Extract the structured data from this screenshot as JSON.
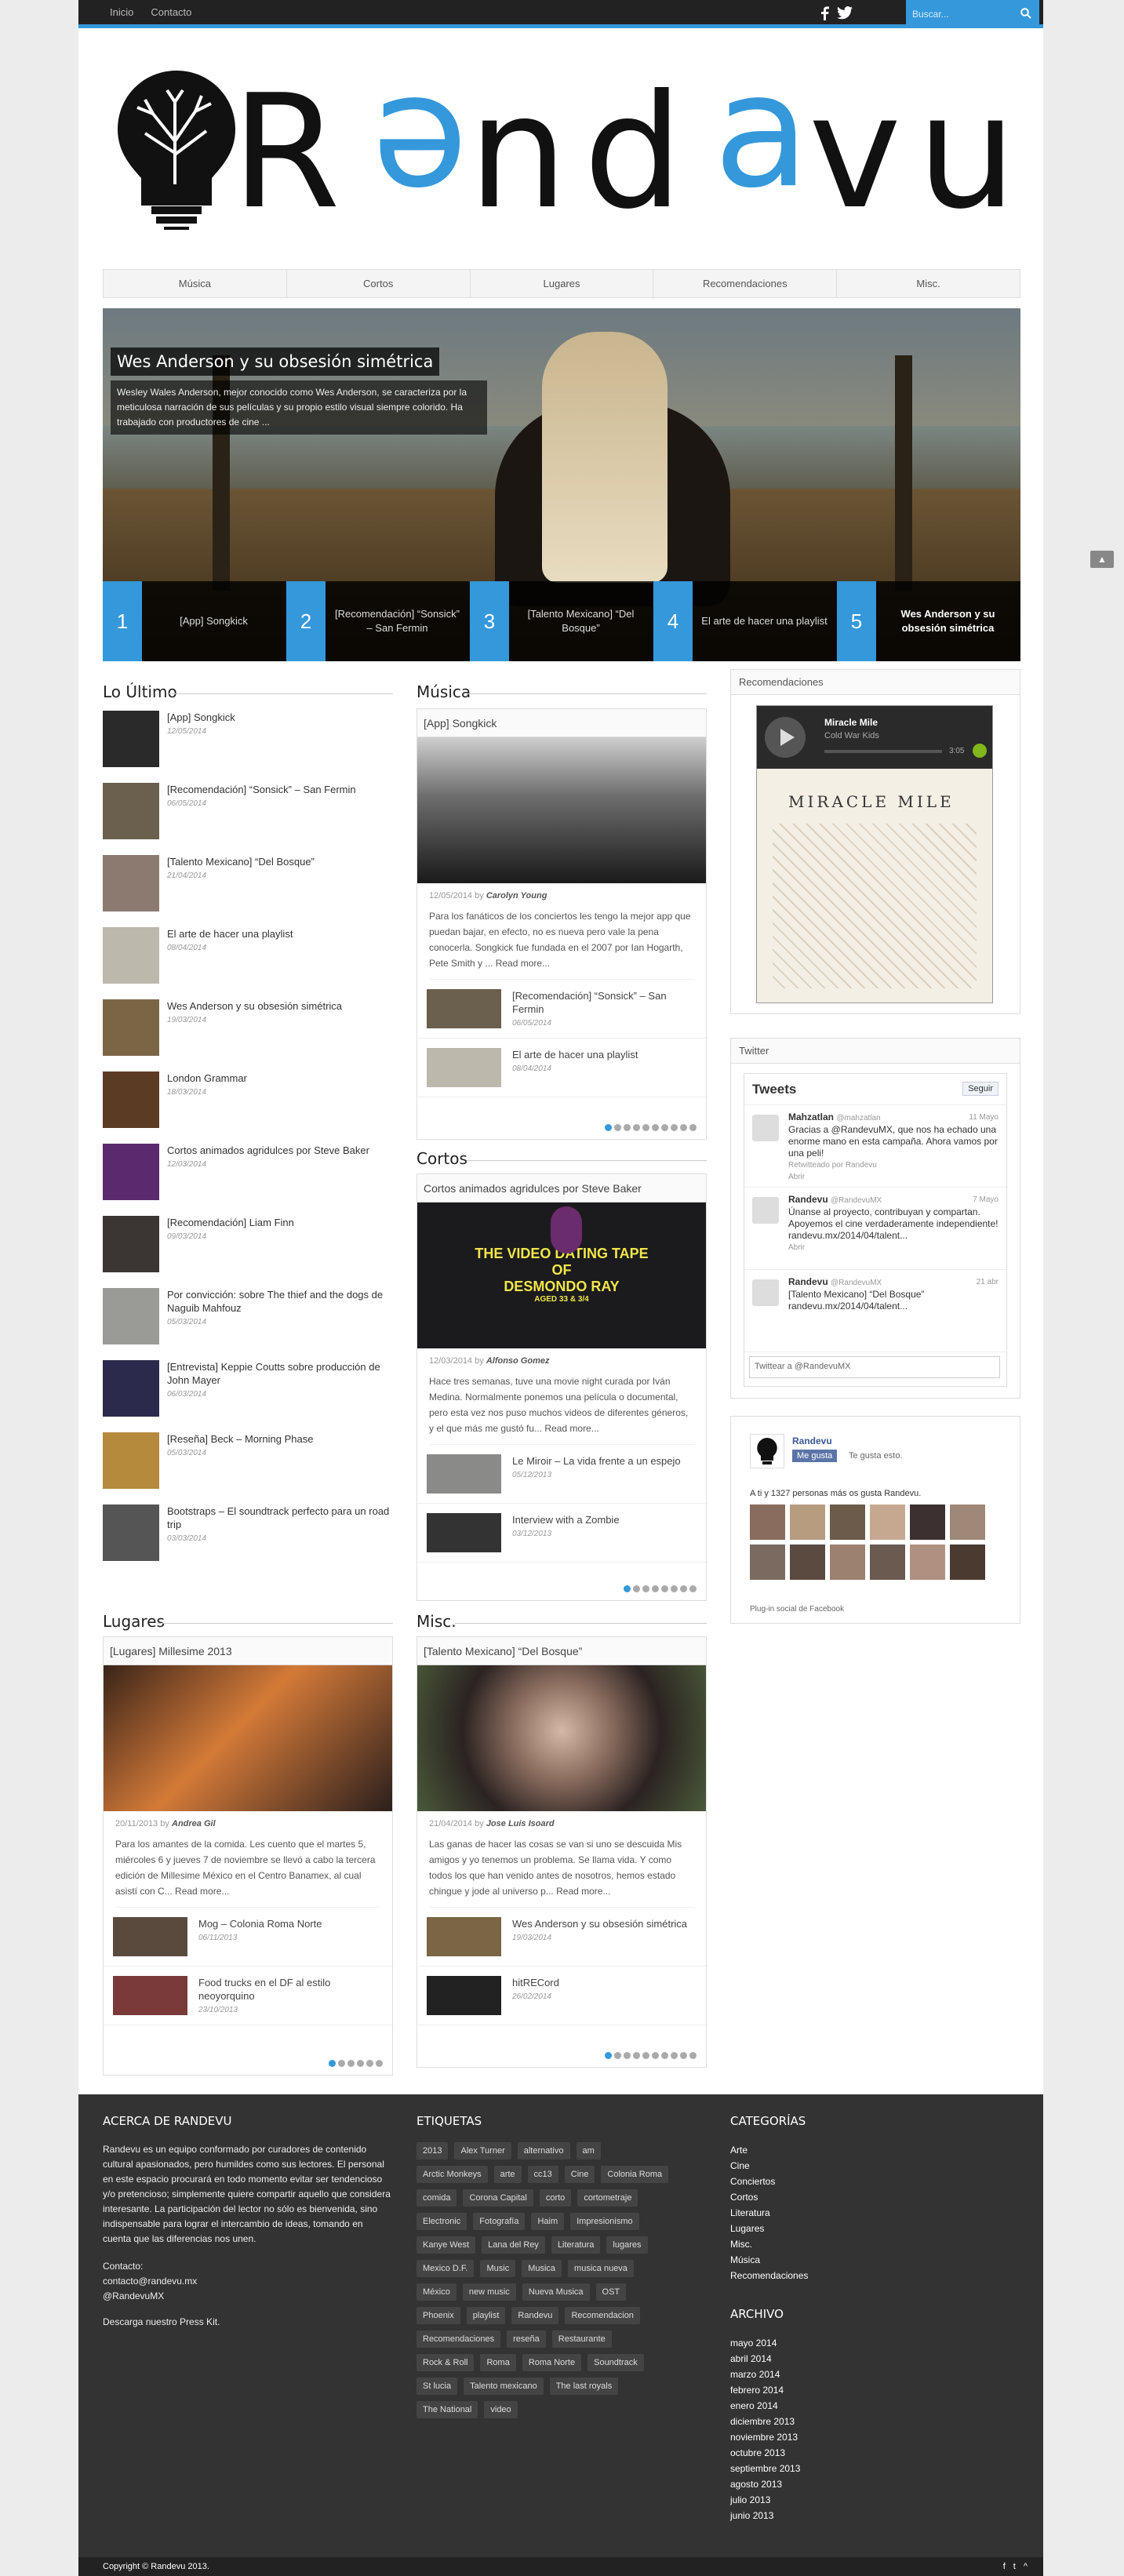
{
  "topnav": {
    "items": [
      "Inicio",
      "Contacto"
    ]
  },
  "search": {
    "placeholder": "Buscar..."
  },
  "logo": {
    "alt": "Randevu"
  },
  "mainnav": {
    "items": [
      "Música",
      "Cortos",
      "Lugares",
      "Recomendaciones",
      "Misc."
    ]
  },
  "slider": {
    "title": "Wes Anderson y su obsesión simétrica",
    "text": "Wesley Wales Anderson, mejor conocido como Wes Anderson, se caracteriza por la meticulosa narración de sus películas y su propio estilo visual siempre colorido. Ha trabajado con productores de cine ...",
    "tabs": [
      {
        "num": "1",
        "label": "[App] Songkick"
      },
      {
        "num": "2",
        "label": "[Recomendación] “Sonsick” – San Fermin"
      },
      {
        "num": "3",
        "label": "[Talento Mexicano] “Del Bosque”"
      },
      {
        "num": "4",
        "label": "El arte de hacer una playlist"
      },
      {
        "num": "5",
        "label": "Wes Anderson y su obsesión simétrica"
      }
    ]
  },
  "latest": {
    "heading": "Lo Último",
    "items": [
      {
        "title": "[App] Songkick",
        "date": "12/05/2014",
        "color": "#2a2a2a"
      },
      {
        "title": "[Recomendación] “Sonsick” – San Fermin",
        "date": "06/05/2014",
        "color": "#6b5f4d"
      },
      {
        "title": "[Talento Mexicano] “Del Bosque”",
        "date": "21/04/2014",
        "color": "#8c7a70"
      },
      {
        "title": "El arte de hacer una playlist",
        "date": "08/04/2014",
        "color": "#bcb8ac"
      },
      {
        "title": "Wes Anderson y su obsesión simétrica",
        "date": "19/03/2014",
        "color": "#7a6645"
      },
      {
        "title": "London Grammar",
        "date": "18/03/2014",
        "color": "#5c3b24"
      },
      {
        "title": "Cortos animados agridulces por Steve Baker",
        "date": "12/03/2014",
        "color": "#5b2a6e"
      },
      {
        "title": "[Recomendación] Liam Finn",
        "date": "09/03/2014",
        "color": "#3b3533"
      },
      {
        "title": "Por convicción: sobre The thief and the dogs de Naguib Mahfouz",
        "date": "05/03/2014",
        "color": "#9a9a96"
      },
      {
        "title": "[Entrevista] Keppie Coutts sobre producción de John Mayer",
        "date": "06/03/2014",
        "color": "#2c2a4c"
      },
      {
        "title": "[Reseña] Beck – Morning Phase",
        "date": "05/03/2014",
        "color": "#b58a3c"
      },
      {
        "title": "Bootstraps – El soundtrack perfecto para un road trip",
        "date": "03/03/2014",
        "color": "#555"
      }
    ]
  },
  "musica": {
    "heading": "Música",
    "title": "[App] Songkick",
    "date": "12/05/2014",
    "by": "by",
    "author": "Carolyn Young",
    "excerpt": "Para los fanáticos de los conciertos les tengo la mejor app que puedan bajar, en efecto, no es nueva pero vale la pena conocerla. Songkick fue fundada en el 2007 por Ian Hogarth, Pete Smith y ... Read more...",
    "subs": [
      {
        "title": "[Recomendación] “Sonsick” – San Fermin",
        "date": "06/05/2014"
      },
      {
        "title": "El arte de hacer una playlist",
        "date": "08/04/2014"
      }
    ]
  },
  "cortos": {
    "heading": "Cortos",
    "title": "Cortos animados agridulces por Steve Baker",
    "poster": {
      "line1": "THE VIDEO DATING TAPE",
      "line2": "OF",
      "line3": "DESMONDO RAY",
      "line4": "AGED 33 & 3/4"
    },
    "date": "12/03/2014",
    "by": "by",
    "author": "Alfonso Gomez",
    "excerpt": "Hace tres semanas, tuve una movie night curada por Iván Medina. Normalmente ponemos una película o documental, pero esta vez nos puso muchos videos de diferentes géneros, y el que más me gustó fu... Read more...",
    "subs": [
      {
        "title": "Le Miroir – La vida frente a un espejo",
        "date": "05/12/2013"
      },
      {
        "title": "Interview with a Zombie",
        "date": "03/12/2013"
      }
    ]
  },
  "lugares": {
    "heading": "Lugares",
    "title": "[Lugares] Millesime 2013",
    "date": "20/11/2013",
    "by": "by",
    "author": "Andrea Gil",
    "excerpt": "Para los amantes de la comida. Les cuento que el martes 5, miércoles 6 y jueves 7 de noviembre se llevó a cabo la tercera edición de Millesime México en el Centro Banamex, al cual asistí con C... Read more...",
    "subs": [
      {
        "title": "Mog – Colonia Roma Norte",
        "date": "06/11/2013"
      },
      {
        "title": "Food trucks en el DF al estilo neoyorquino",
        "date": "23/10/2013"
      }
    ]
  },
  "misc": {
    "heading": "Misc.",
    "title": "[Talento Mexicano] “Del Bosque”",
    "date": "21/04/2014",
    "by": "by",
    "author": "Jose Luis Isoard",
    "excerpt": "Las ganas de hacer las cosas se van si uno se descuida Mis amigos y yo tenemos un problema. Se llama vida. Y como todos los que han venido antes de nosotros, hemos estado chingue y jode al universo p... Read more...",
    "subs": [
      {
        "title": "Wes Anderson y su obsesión simétrica",
        "date": "19/03/2014"
      },
      {
        "title": "hitRECord",
        "date": "26/02/2014"
      }
    ]
  },
  "recomendaciones": {
    "heading": "Recomendaciones",
    "track": "Miracle Mile",
    "artist": "Cold War Kids",
    "time": "3:05",
    "album": "MIRACLE MILE"
  },
  "twitter": {
    "heading": "Twitter",
    "title": "Tweets",
    "follow": "Seguir",
    "tweets": [
      {
        "name": "Mahzatlan",
        "handle": "@mahzatlan",
        "date": "11 Mayo",
        "text": "Gracias a @RandevuMX, que nos ha echado una enorme mano en esta campaña. Ahora vamos por una peli!",
        "extra": "Retwitteado por Randevu",
        "action": "Abrir"
      },
      {
        "name": "Randevu",
        "handle": "@RandevuMX",
        "date": "7 Mayo",
        "text": "Únanse al proyecto, contribuyan y compartan. Apoyemos el cine verdaderamente independiente! randevu.mx/2014/04/talent...",
        "extra": "",
        "action": "Abrir"
      },
      {
        "name": "Randevu",
        "handle": "@RandevuMX",
        "date": "21 abr",
        "text": "[Talento Mexicano] “Del Bosque” randevu.mx/2014/04/talent...",
        "extra": "",
        "action": ""
      }
    ],
    "compose": "Twittear a @RandevuMX"
  },
  "facebook": {
    "page": "Randevu",
    "like": "Me gusta",
    "likes_text": "Te gusta esto.",
    "count_text": "A ti y 1327 personas más os gusta Randevu.",
    "plugin": "Plug-in social de Facebook"
  },
  "footer": {
    "about_h": "ACERCA DE RANDEVU",
    "about": "Randevu es un equipo conformado por curadores de contenido cultural apasionados, pero humildes como sus lectores. El personal en este espacio procurará en todo momento evitar ser tendencioso y/o pretencioso; simplemente quiere compartir aquello que considera interesante. La participación del lector no sólo es bienvenida, sino indispensable para lograr el intercambio de ideas, tomando en cuenta que las diferencias nos unen.",
    "contact_h": "Contacto:",
    "email": "contacto@randevu.mx",
    "twitter": "@RandevuMX",
    "press": "Descarga nuestro Press Kit.",
    "tags_h": "ETIQUETAS",
    "tags": [
      "2013",
      "Alex Turner",
      "alternativo",
      "am",
      "Arctic Monkeys",
      "arte",
      "cc13",
      "Cine",
      "Colonia Roma",
      "comida",
      "Corona Capital",
      "corto",
      "cortometraje",
      "Electronic",
      "Fotografía",
      "Haim",
      "Impresionismo",
      "Kanye West",
      "Lana del Rey",
      "Literatura",
      "lugares",
      "Mexico D.F.",
      "Music",
      "Musica",
      "musica nueva",
      "México",
      "new music",
      "Nueva Musica",
      "OST",
      "Phoenix",
      "playlist",
      "Randevu",
      "Recomendacion",
      "Recomendaciones",
      "reseña",
      "Restaurante",
      "Rock & Roll",
      "Roma",
      "Roma Norte",
      "Soundtrack",
      "St lucia",
      "Talento mexicano",
      "The last royals",
      "The National",
      "video"
    ],
    "cats_h": "CATEGORÍAS",
    "cats": [
      "Arte",
      "Cine",
      "Conciertos",
      "Cortos",
      "Literatura",
      "Lugares",
      "Misc.",
      "Música",
      "Recomendaciones"
    ],
    "arch_h": "ARCHIVO",
    "archive": [
      "mayo 2014",
      "abril 2014",
      "marzo 2014",
      "febrero 2014",
      "enero 2014",
      "diciembre 2013",
      "noviembre 2013",
      "octubre 2013",
      "septiembre 2013",
      "agosto 2013",
      "julio 2013",
      "junio 2013"
    ],
    "copyright": "Copyright © Randevu 2013."
  },
  "colors": {
    "accent": "#3498db",
    "footer": "#333333",
    "topbar": "#222222"
  }
}
